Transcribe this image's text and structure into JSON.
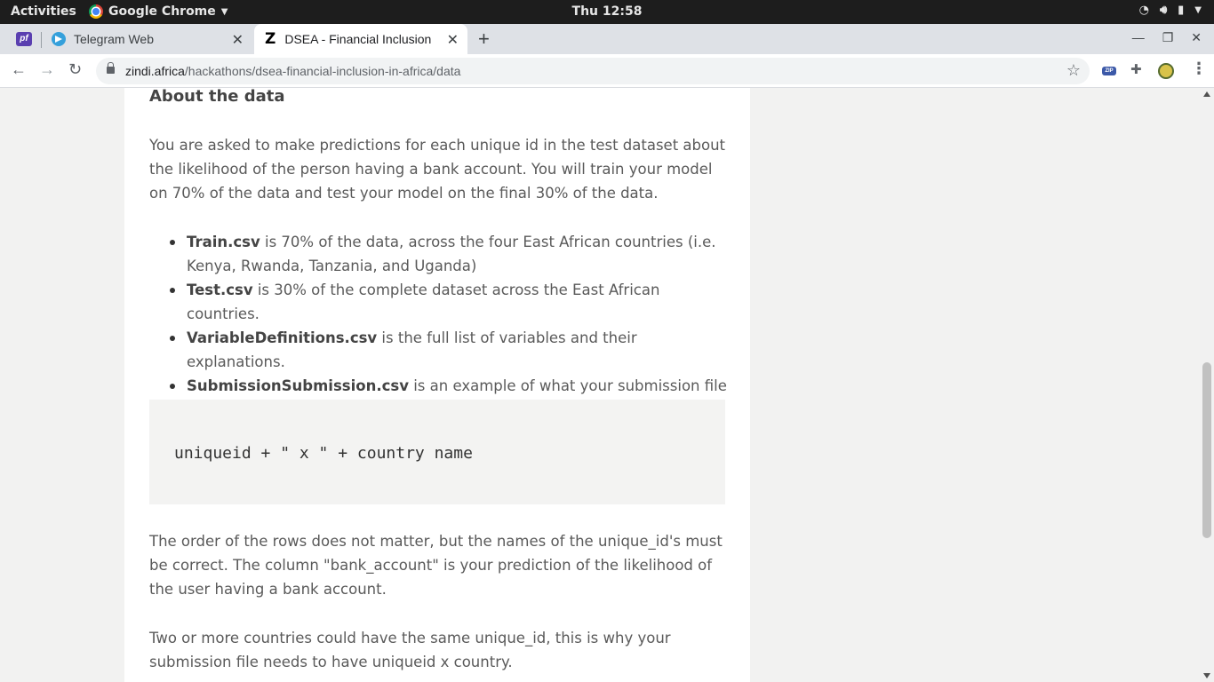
{
  "topbar": {
    "activities": "Activities",
    "app_name": "Google Chrome",
    "clock": "Thu 12:58"
  },
  "tabs": [
    {
      "title": "Telegram Web",
      "active": false
    },
    {
      "title": "DSEA - Financial Inclusion",
      "active": true
    }
  ],
  "toolbar": {
    "url_host": "zindi.africa",
    "url_path": "/hackathons/dsea-financial-inclusion-in-africa/data",
    "zip_label": "ZIP"
  },
  "page": {
    "heading": "About the data",
    "intro": "You are asked to make predictions for each unique id in the test dataset about the likelihood of the person having a bank account. You will train your model on 70% of the data and test your model on the final 30% of the data.",
    "files": [
      {
        "name": "Train.csv",
        "desc": " is 70% of the data, across the four East African countries (i.e. Kenya, Rwanda, Tanzania, and Uganda)"
      },
      {
        "name": "Test.csv",
        "desc": " is 30% of the complete dataset across the East African countries."
      },
      {
        "name": "VariableDefinitions.csv",
        "desc": " is the full list of variables and their explanations."
      },
      {
        "name": "SubmissionSubmission.csv",
        "desc": " is an example of what your submission file should look like. Note that the variable unique_id in the submission file is:"
      }
    ],
    "code": "uniqueid + \" x \" + country name",
    "order_note": "The order of the rows does not matter, but the names of the unique_id's must be correct. The column \"bank_account\" is your prediction of the likelihood of the user having a bank account.",
    "countries_note": "Two or more countries could have the same unique_id, this is why your submission file needs to have uniqueid x country."
  }
}
